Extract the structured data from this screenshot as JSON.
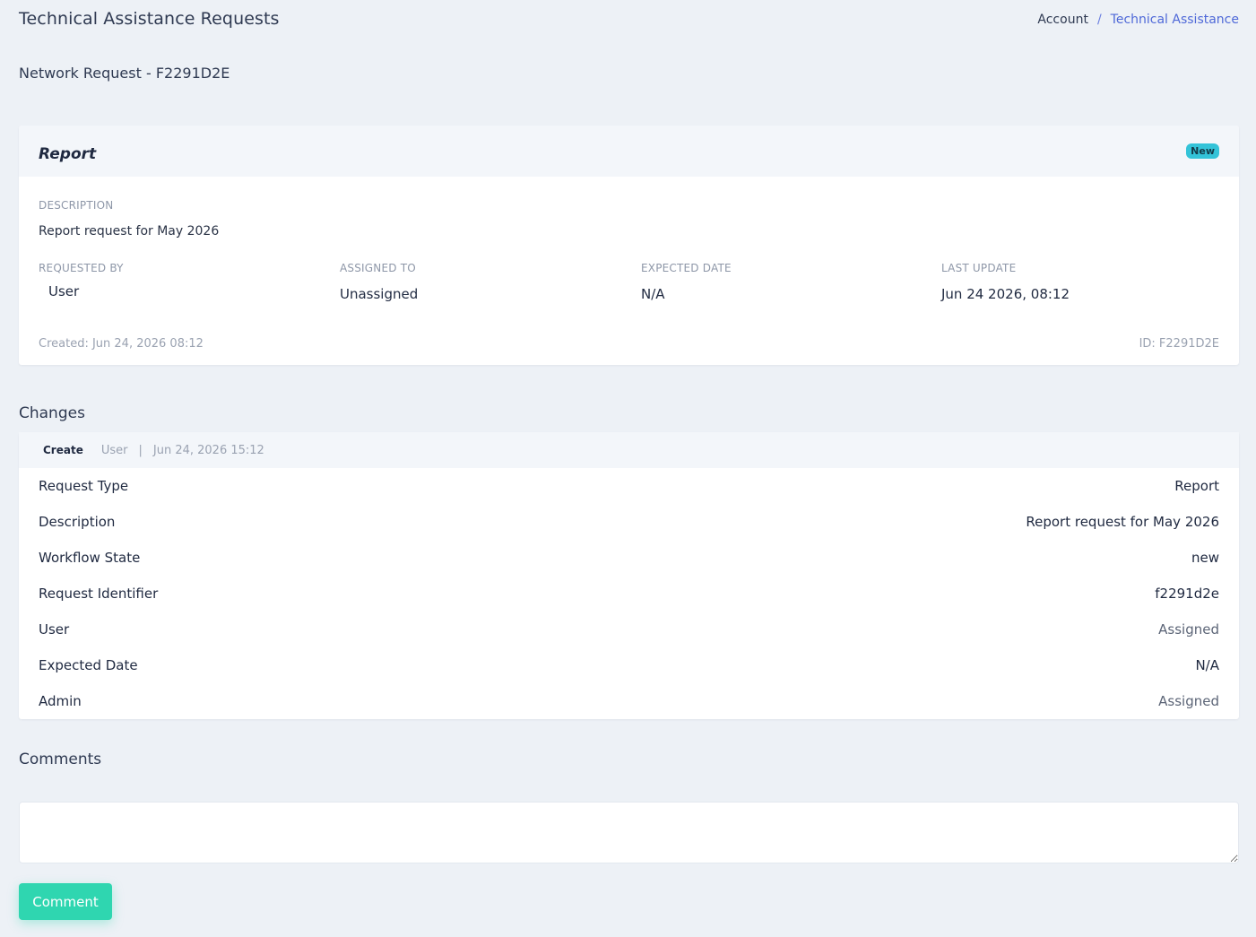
{
  "header": {
    "title": "Technical Assistance Requests",
    "breadcrumb": {
      "account": "Account",
      "separator": "/",
      "current": "Technical Assistance"
    }
  },
  "subtitle": "Network Request - F2291D2E",
  "report": {
    "title": "Report",
    "status": "New",
    "description_label": "DESCRIPTION",
    "description": "Report request for May 2026",
    "meta": [
      {
        "label": "REQUESTED BY",
        "value": "User"
      },
      {
        "label": "ASSIGNED TO",
        "value": "Unassigned"
      },
      {
        "label": "EXPECTED DATE",
        "value": "N/A"
      },
      {
        "label": "LAST UPDATE",
        "value": "Jun 24 2026, 08:12"
      }
    ],
    "created": "Created: Jun 24, 2026 08:12",
    "id": "ID: F2291D2E"
  },
  "changes": {
    "heading": "Changes",
    "entry": {
      "action": "Create",
      "user": "User",
      "separator": "|",
      "date": "Jun 24, 2026 15:12"
    },
    "rows": [
      {
        "key": "Request Type",
        "value": "Report"
      },
      {
        "key": "Description",
        "value": "Report request for May 2026"
      },
      {
        "key": "Workflow State",
        "value": "new"
      },
      {
        "key": "Request Identifier",
        "value": "f2291d2e"
      },
      {
        "key": "User",
        "value": "Assigned"
      },
      {
        "key": "Expected Date",
        "value": "N/A"
      },
      {
        "key": "Admin",
        "value": "Assigned"
      }
    ]
  },
  "comments": {
    "heading": "Comments",
    "input_value": "",
    "button_label": "Comment"
  },
  "colors": {
    "accent": "#4f69d8",
    "badge": "#33c3d8",
    "button": "#2fd6b0",
    "background": "#edf1f6"
  }
}
